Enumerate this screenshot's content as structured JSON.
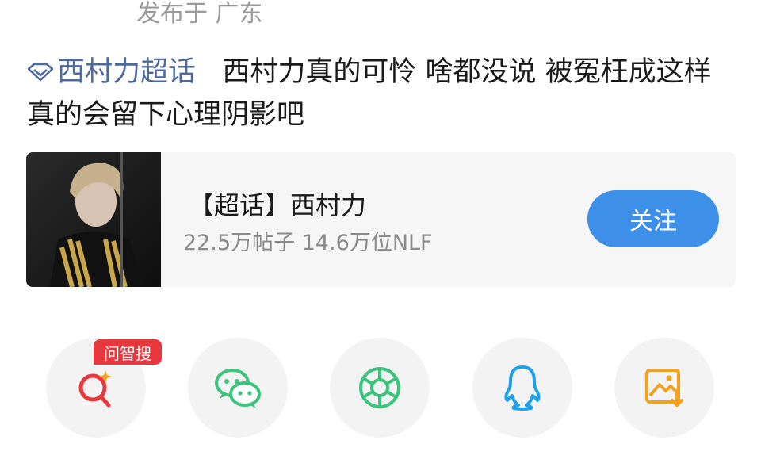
{
  "post": {
    "location_label": "发布于 广东",
    "topic_name": "西村力超话",
    "body": "西村力真的可怜 啥都没说 被冤枉成这样 真的会留下心理阴影吧"
  },
  "topic_card": {
    "title": "【超话】西村力",
    "stats": "22.5万帖子 14.6万位NLF",
    "follow_label": "关注"
  },
  "share": {
    "badge_label": "问智搜",
    "items": [
      {
        "icon": "search-sparkle-icon",
        "color": "#e8383d"
      },
      {
        "icon": "wechat-icon",
        "color": "#3cc47c"
      },
      {
        "icon": "moments-icon",
        "color": "#3cc47c"
      },
      {
        "icon": "qq-icon",
        "color": "#1fa1e8"
      },
      {
        "icon": "save-image-icon",
        "color": "#f2a21f"
      }
    ]
  }
}
